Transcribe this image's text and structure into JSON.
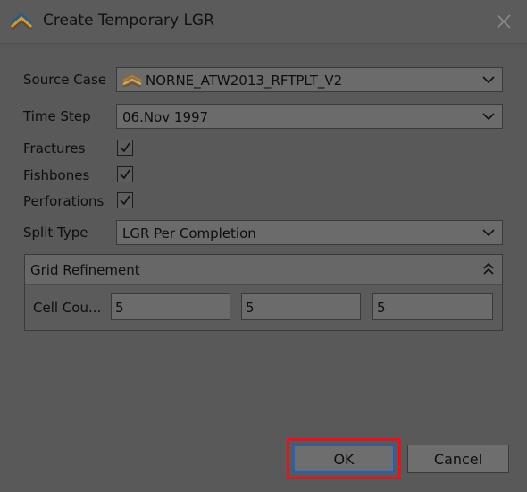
{
  "window": {
    "title": "Create Temporary LGR",
    "icon": "resinsight-layers-icon",
    "close_icon": "close-icon"
  },
  "form": {
    "source_case": {
      "label": "Source Case",
      "value": "NORNE_ATW2013_RFTPLT_V2",
      "icon": "case-layers-icon"
    },
    "time_step": {
      "label": "Time Step",
      "value": "06.Nov 1997"
    },
    "fractures": {
      "label": "Fractures",
      "checked": true
    },
    "fishbones": {
      "label": "Fishbones",
      "checked": true
    },
    "perforations": {
      "label": "Perforations",
      "checked": true
    },
    "split_type": {
      "label": "Split Type",
      "value": "LGR Per Completion"
    }
  },
  "grid_refinement": {
    "title": "Grid Refinement",
    "cell_count_label": "Cell Cou...",
    "values": [
      "5",
      "5",
      "5"
    ]
  },
  "buttons": {
    "ok": "OK",
    "cancel": "Cancel"
  },
  "colors": {
    "highlight": "#e5121f",
    "focus": "#1f5fc7"
  }
}
